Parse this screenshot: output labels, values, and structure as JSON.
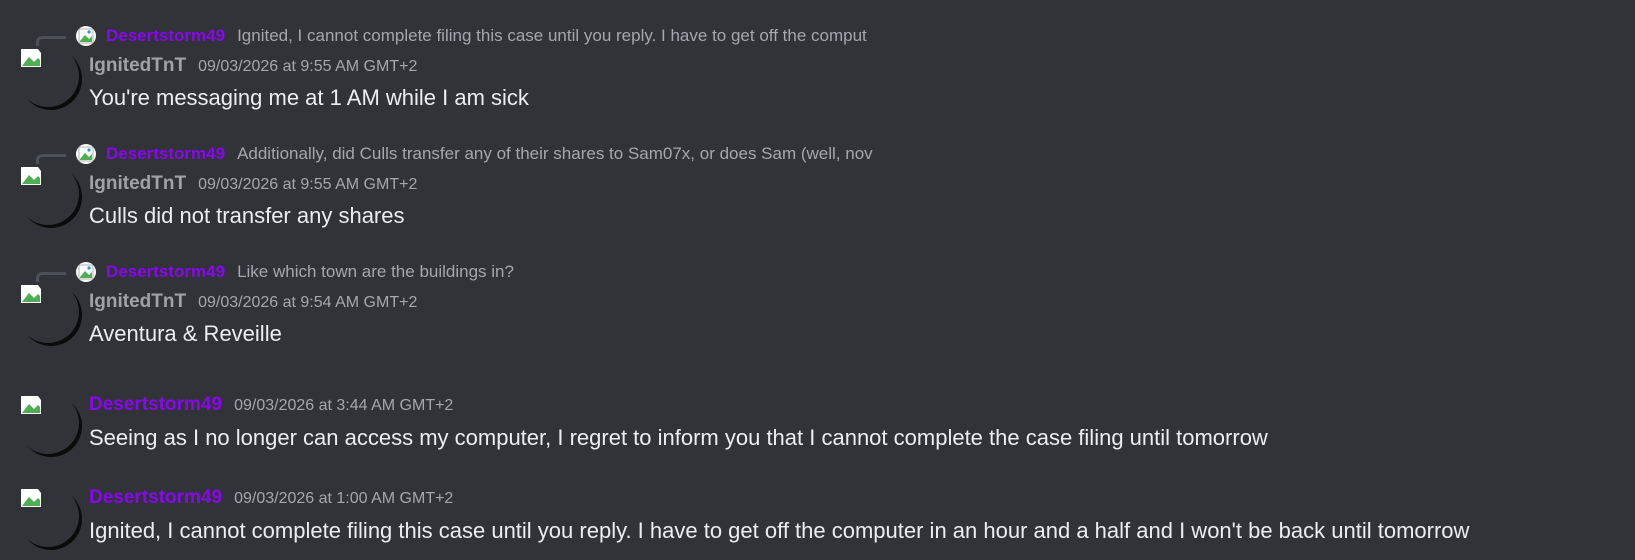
{
  "colors": {
    "background": "#313338",
    "username_purple": "#8a06f0",
    "username_grey": "#a0a2a7",
    "timestamp": "#a5a7ad",
    "message_text": "#ebedf2"
  },
  "messages": [
    {
      "reply": {
        "user": "Desertstorm49",
        "text": "Ignited, I cannot complete filing this case until you reply. I have to get off the comput"
      },
      "author": "IgnitedTnT",
      "timestamp": "09/03/2026 at 9:55 AM GMT+2",
      "content": "You're messaging me at 1 AM while I am sick"
    },
    {
      "reply": {
        "user": "Desertstorm49",
        "text": "Additionally, did Culls transfer any of their shares to Sam07x, or does Sam (well, nov"
      },
      "author": "IgnitedTnT",
      "timestamp": "09/03/2026 at 9:55 AM GMT+2",
      "content": "Culls did not transfer any shares"
    },
    {
      "reply": {
        "user": "Desertstorm49",
        "text": "Like which town are the buildings in?"
      },
      "author": "IgnitedTnT",
      "timestamp": "09/03/2026 at 9:54 AM GMT+2",
      "content": "Aventura & Reveille"
    },
    {
      "author": "Desertstorm49",
      "timestamp": "09/03/2026 at 3:44 AM GMT+2",
      "content": "Seeing as I no longer can access my computer, I regret to inform you that I cannot complete the case filing until tomorrow"
    },
    {
      "author": "Desertstorm49",
      "timestamp": "09/03/2026 at 1:00 AM GMT+2",
      "content": "Ignited, I cannot complete filing this case until you reply. I have to get off the computer in an hour and a half and I won't be back until tomorrow"
    }
  ]
}
